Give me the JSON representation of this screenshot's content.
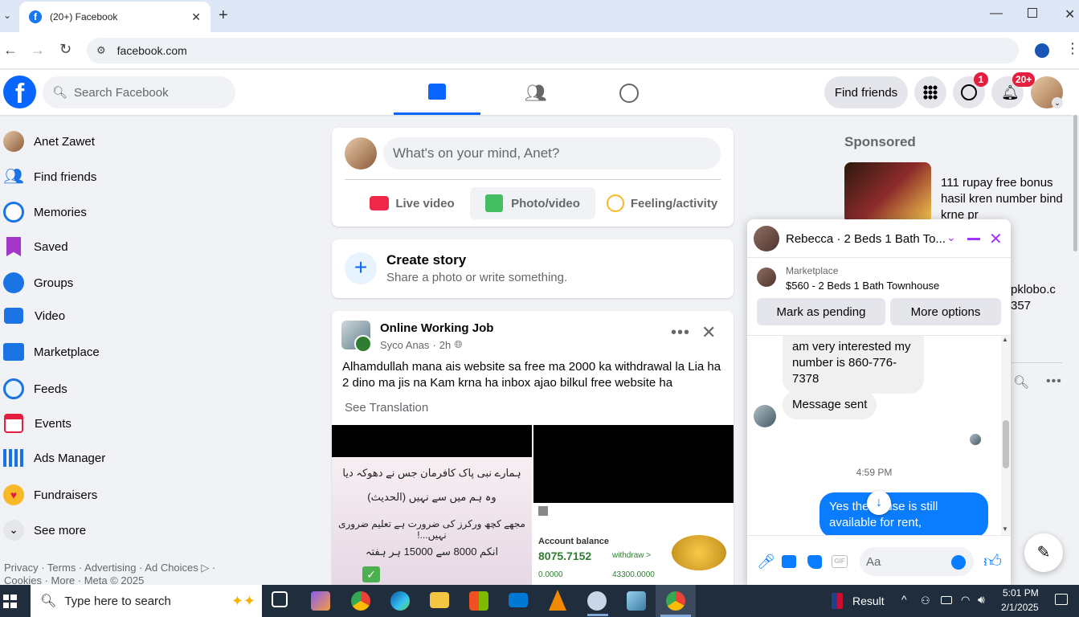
{
  "browser": {
    "tab_title": "(20+) Facebook",
    "url": "facebook.com"
  },
  "header": {
    "search_placeholder": "Search Facebook",
    "find_friends": "Find friends",
    "messenger_badge": "1",
    "notifications_badge": "20+"
  },
  "sidebar": {
    "items": [
      {
        "label": "Anet Zawet",
        "icon": "avatar"
      },
      {
        "label": "Find friends",
        "icon": "friends-icon"
      },
      {
        "label": "Memories",
        "icon": "clock-icon"
      },
      {
        "label": "Saved",
        "icon": "bookmark-icon"
      },
      {
        "label": "Groups",
        "icon": "groups-icon"
      },
      {
        "label": "Video",
        "icon": "video-icon"
      },
      {
        "label": "Marketplace",
        "icon": "shop-icon"
      },
      {
        "label": "Feeds",
        "icon": "feeds-icon"
      },
      {
        "label": "Events",
        "icon": "calendar-icon"
      },
      {
        "label": "Ads Manager",
        "icon": "bar-chart-icon"
      },
      {
        "label": "Fundraisers",
        "icon": "heart-icon"
      },
      {
        "label": "See more",
        "icon": "chevron-down-icon"
      }
    ],
    "footer_line1": "Privacy · Terms · Advertising · Ad Choices ▷ ·",
    "footer_line2": "Cookies · More · Meta © 2025"
  },
  "composer": {
    "placeholder": "What's on your mind, Anet?",
    "live_video": "Live video",
    "photo_video": "Photo/video",
    "feeling": "Feeling/activity"
  },
  "story": {
    "title": "Create story",
    "subtitle": "Share a photo or write something."
  },
  "post": {
    "group": "Online Working Job",
    "author": "Syco Anas",
    "time": "2h",
    "text": "Alhamdullah mana ais website sa free ma 2000 ka withdrawal la Lia ha 2 dino ma jis na Kam krna ha inbox ajao bilkul free website ha",
    "see_translation": "See Translation",
    "img_urdu_1": "ہمارے نبی پاک کافرمان جس نے دھوکہ دیا",
    "img_urdu_2": "وہ ہم میں سے نہیں (الحدیث)",
    "img_urdu_3": "مجھے کچھ ورکرز کی ضرورت ہے تعلیم ضروری نہیں...!",
    "img_urdu_4": "انکم 8000 سے 15000 ہر ہفتہ",
    "acct_label": "Account balance",
    "acct_value": "8075.7152",
    "withdraw": "withdraw >",
    "acct_small1": "0.0000",
    "acct_small2": "43300.0000"
  },
  "sponsored": {
    "label": "Sponsored",
    "ad_text": "111 rupay free bonus hasil kren number bind krne pr",
    "ad2_partial_1": "pklobo.c",
    "ad2_partial_2": "357"
  },
  "chat": {
    "title": "Rebecca · 2 Beds 1 Bath To...",
    "listing_label": "Marketplace",
    "listing_title": "$560 - 2 Beds 1 Bath Townhouse",
    "mark_pending": "Mark as pending",
    "more_options": "More options",
    "msg1": "am very interested my number is 860-776-7378",
    "msg2": "Message sent",
    "timestamp": "4:59 PM",
    "msg3": "Yes the house is still available for rent,",
    "input_placeholder": "Aa"
  },
  "taskbar": {
    "search_placeholder": "Type here to search",
    "result": "Result",
    "time": "5:01 PM",
    "date": "2/1/2025"
  }
}
